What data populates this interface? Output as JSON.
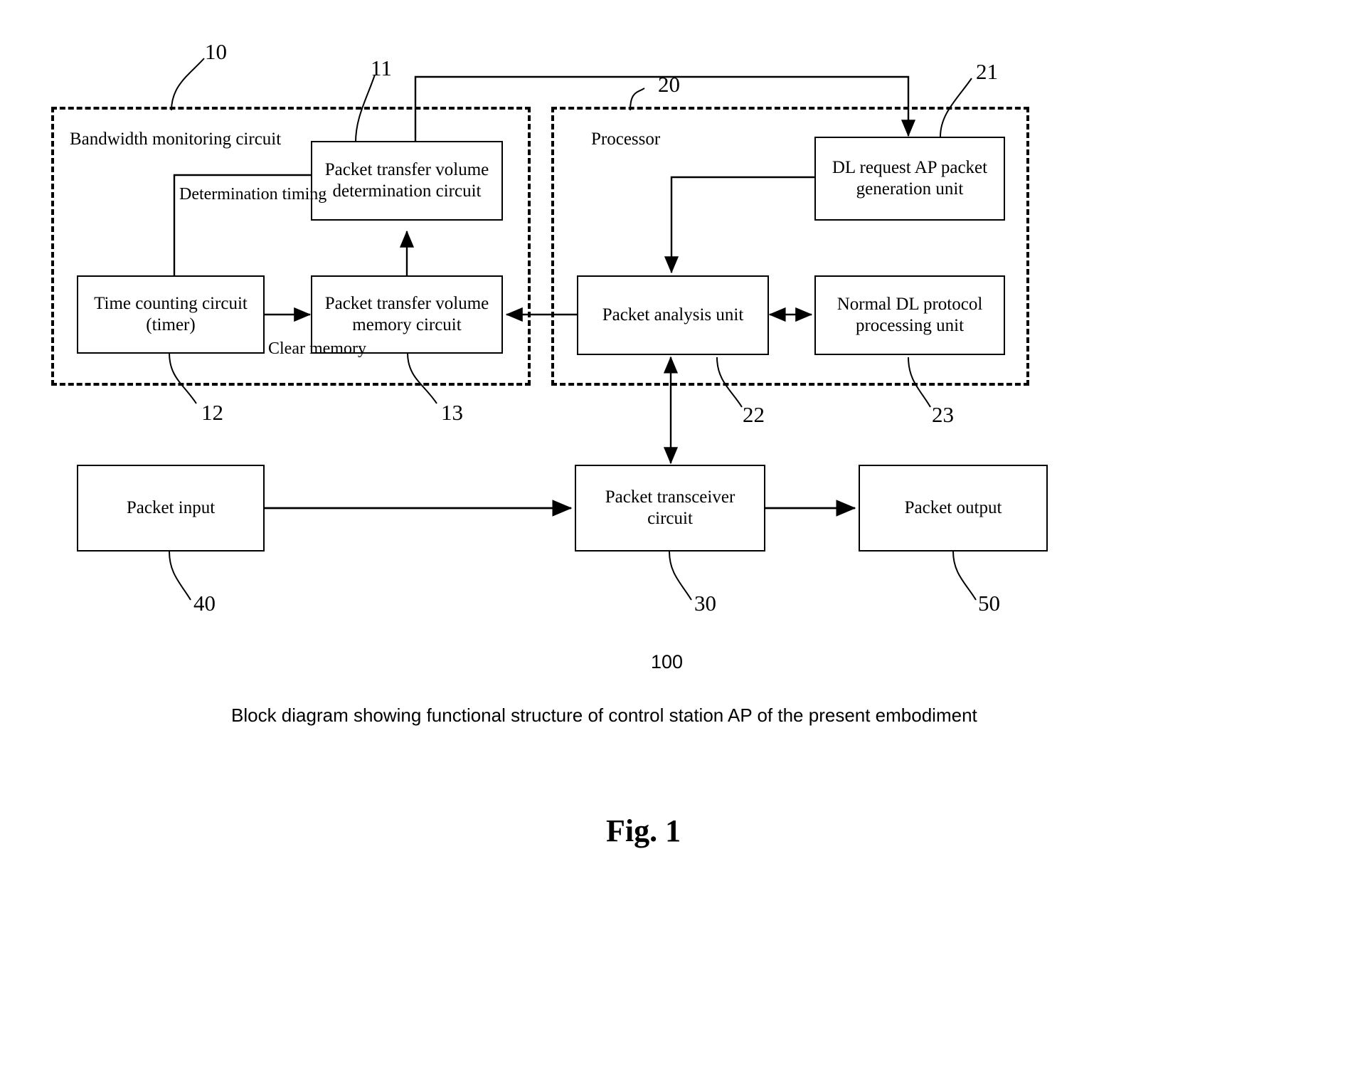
{
  "figure": {
    "label": "Fig. 1",
    "caption": "Block diagram showing functional structure of control station AP of the present embodiment",
    "system_ref": "100"
  },
  "groups": [
    {
      "id": "bandwidth",
      "label": "Bandwidth monitoring circuit",
      "ref": "10"
    },
    {
      "id": "processor",
      "label": "Processor",
      "ref": "20"
    }
  ],
  "boxes": {
    "determination_circuit": {
      "line1": "Packet transfer volume",
      "line2": "determination circuit",
      "ref": "11"
    },
    "time_counting_circuit": {
      "line1": "Time counting circuit",
      "line2": "(timer)",
      "ref": "12"
    },
    "memory_circuit": {
      "line1": "Packet transfer volume",
      "line2": "memory circuit",
      "ref": "13"
    },
    "dl_request_unit": {
      "line1": "DL request AP packet",
      "line2": "generation unit",
      "ref": "21"
    },
    "packet_analysis_unit": {
      "line1": "Packet analysis unit",
      "line2": "",
      "ref": "22"
    },
    "normal_dl_unit": {
      "line1": "Normal DL protocol",
      "line2": "processing unit",
      "ref": "23"
    },
    "packet_input": {
      "line1": "Packet input",
      "line2": "",
      "ref": "40"
    },
    "packet_transceiver": {
      "line1": "Packet transceiver",
      "line2": "circuit",
      "ref": "30"
    },
    "packet_output": {
      "line1": "Packet output",
      "line2": "",
      "ref": "50"
    }
  },
  "edge_labels": {
    "determination_timing": {
      "line1": "Determination",
      "line2": "timing"
    },
    "clear_memory": {
      "line1": "Clear",
      "line2": "memory"
    }
  }
}
